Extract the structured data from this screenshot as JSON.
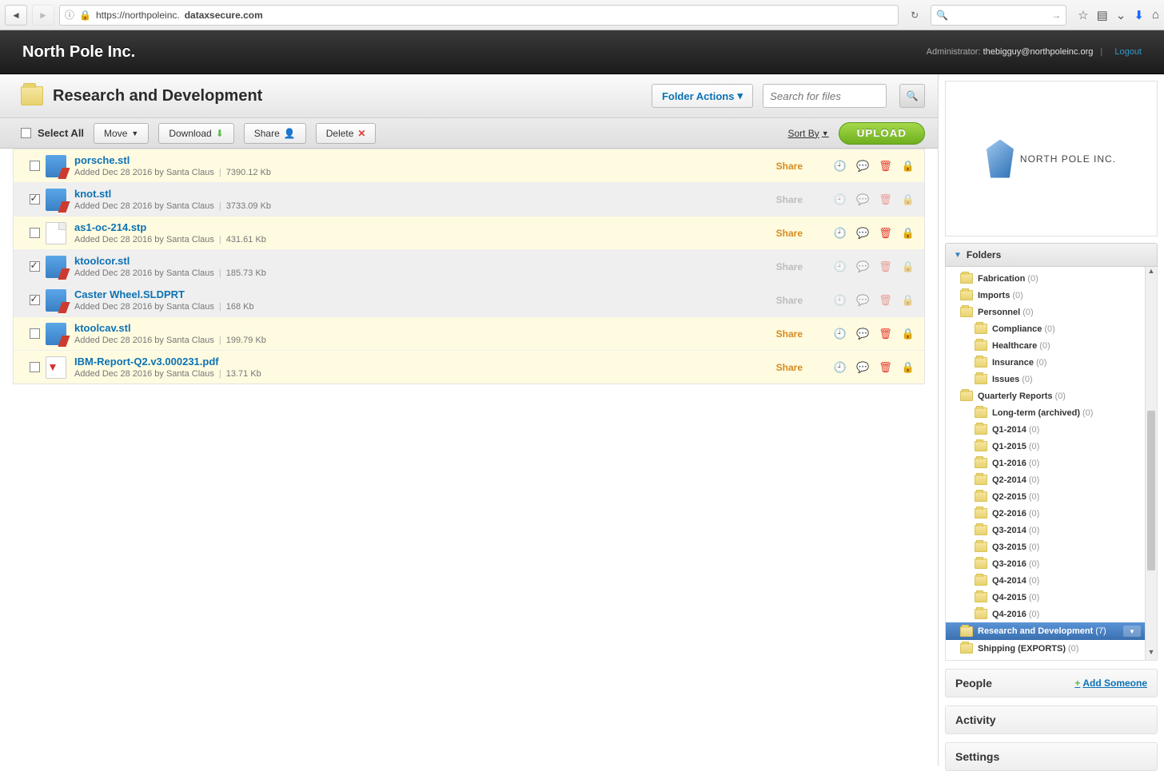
{
  "browser": {
    "url_prefix": "https://northpoleinc.",
    "url_domain": "dataxsecure.com",
    "search_placeholder": ""
  },
  "header": {
    "company": "North Pole Inc.",
    "admin_label": "Administrator:",
    "admin_email": "thebigguy@northpoleinc.org",
    "logout": "Logout"
  },
  "titlebar": {
    "folder_name": "Research and Development",
    "folder_actions": "Folder Actions",
    "search_placeholder": "Search for files"
  },
  "toolbar": {
    "select_all": "Select All",
    "move": "Move",
    "download": "Download",
    "share": "Share",
    "delete": "Delete",
    "sort_by": "Sort By",
    "upload": "UPLOAD"
  },
  "share_label": "Share",
  "files": [
    {
      "name": "porsche.stl",
      "added": "Added Dec 28 2016 by Santa Claus",
      "size": "7390.12 Kb",
      "type": "stl",
      "selected": false
    },
    {
      "name": "knot.stl",
      "added": "Added Dec 28 2016 by Santa Claus",
      "size": "3733.09 Kb",
      "type": "stl",
      "selected": true
    },
    {
      "name": "as1-oc-214.stp",
      "added": "Added Dec 28 2016 by Santa Claus",
      "size": "431.61 Kb",
      "type": "stp",
      "selected": false
    },
    {
      "name": "ktoolcor.stl",
      "added": "Added Dec 28 2016 by Santa Claus",
      "size": "185.73 Kb",
      "type": "stl",
      "selected": true
    },
    {
      "name": "Caster Wheel.SLDPRT",
      "added": "Added Dec 28 2016 by Santa Claus",
      "size": "168 Kb",
      "type": "stl",
      "selected": true
    },
    {
      "name": "ktoolcav.stl",
      "added": "Added Dec 28 2016 by Santa Claus",
      "size": "199.79 Kb",
      "type": "stl",
      "selected": false
    },
    {
      "name": "IBM-Report-Q2.v3.000231.pdf",
      "added": "Added Dec 28 2016 by Santa Claus",
      "size": "13.71 Kb",
      "type": "pdf",
      "selected": false
    }
  ],
  "sidebar": {
    "brand_text": "NORTH POLE INC.",
    "folders_header": "Folders",
    "people_header": "People",
    "add_someone": "Add Someone",
    "activity_header": "Activity",
    "settings_header": "Settings",
    "tree": [
      {
        "label": "Fabrication",
        "count": "(0)",
        "depth": 0
      },
      {
        "label": "Imports",
        "count": "(0)",
        "depth": 0
      },
      {
        "label": "Personnel",
        "count": "(0)",
        "depth": 0
      },
      {
        "label": "Compliance",
        "count": "(0)",
        "depth": 1
      },
      {
        "label": "Healthcare",
        "count": "(0)",
        "depth": 1
      },
      {
        "label": "Insurance",
        "count": "(0)",
        "depth": 1
      },
      {
        "label": "Issues",
        "count": "(0)",
        "depth": 1
      },
      {
        "label": "Quarterly Reports",
        "count": "(0)",
        "depth": 0
      },
      {
        "label": "Long-term (archived)",
        "count": "(0)",
        "depth": 1
      },
      {
        "label": "Q1-2014",
        "count": "(0)",
        "depth": 1
      },
      {
        "label": "Q1-2015",
        "count": "(0)",
        "depth": 1
      },
      {
        "label": "Q1-2016",
        "count": "(0)",
        "depth": 1
      },
      {
        "label": "Q2-2014",
        "count": "(0)",
        "depth": 1
      },
      {
        "label": "Q2-2015",
        "count": "(0)",
        "depth": 1
      },
      {
        "label": "Q2-2016",
        "count": "(0)",
        "depth": 1
      },
      {
        "label": "Q3-2014",
        "count": "(0)",
        "depth": 1
      },
      {
        "label": "Q3-2015",
        "count": "(0)",
        "depth": 1
      },
      {
        "label": "Q3-2016",
        "count": "(0)",
        "depth": 1
      },
      {
        "label": "Q4-2014",
        "count": "(0)",
        "depth": 1
      },
      {
        "label": "Q4-2015",
        "count": "(0)",
        "depth": 1
      },
      {
        "label": "Q4-2016",
        "count": "(0)",
        "depth": 1
      },
      {
        "label": "Research and Development",
        "count": "(7)",
        "depth": 0,
        "selected": true
      },
      {
        "label": "Shipping (EXPORTS)",
        "count": "(0)",
        "depth": 0
      }
    ]
  }
}
